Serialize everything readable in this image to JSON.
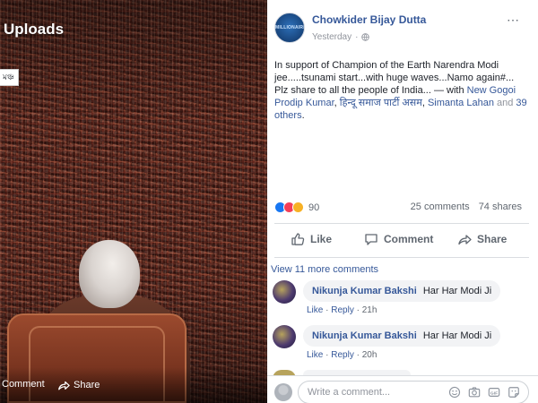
{
  "photo_pane": {
    "title": "Uploads",
    "tag": "মঞ্চ",
    "comment_label": "Comment",
    "share_label": "Share"
  },
  "post": {
    "author": "Chowkider Bijay Dutta",
    "avatar_text": "MILLIONAIRE",
    "timestamp": "Yesterday",
    "privacy_separator": "·",
    "text_main": "In support of Champion of the Earth Narendra Modi jee.....tsunami start...with huge waves...Namo again#...",
    "text_share": "Plz share to all the people of India... — with",
    "tagged_1": "New Gogoi Prodip Kumar",
    "tagged_2": "हिन्दू समाज पार्टी असम",
    "tagged_3": "Simanta Lahan",
    "and_label": "and",
    "others_label": "39 others",
    "reaction_count": "90",
    "comments_count": "25 comments",
    "shares_count": "74 shares"
  },
  "actions": {
    "like": "Like",
    "comment": "Comment",
    "share": "Share"
  },
  "comments_section": {
    "view_more": "View 11 more comments",
    "items": [
      {
        "name": "Nikunja Kumar Bakshi",
        "text": "Har Har Modi Ji",
        "like": "Like",
        "reply": "Reply",
        "time": "21h",
        "sep": "·"
      },
      {
        "name": "Nikunja Kumar Bakshi",
        "text": "Har Har Modi Ji",
        "like": "Like",
        "reply": "Reply",
        "time": "20h",
        "sep": "·"
      }
    ],
    "write_placeholder": "Write a comment..."
  },
  "colors": {
    "link": "#365899",
    "like_reaction": "#1877f2",
    "love_reaction": "#f33e58",
    "haha_reaction": "#f7b125"
  }
}
